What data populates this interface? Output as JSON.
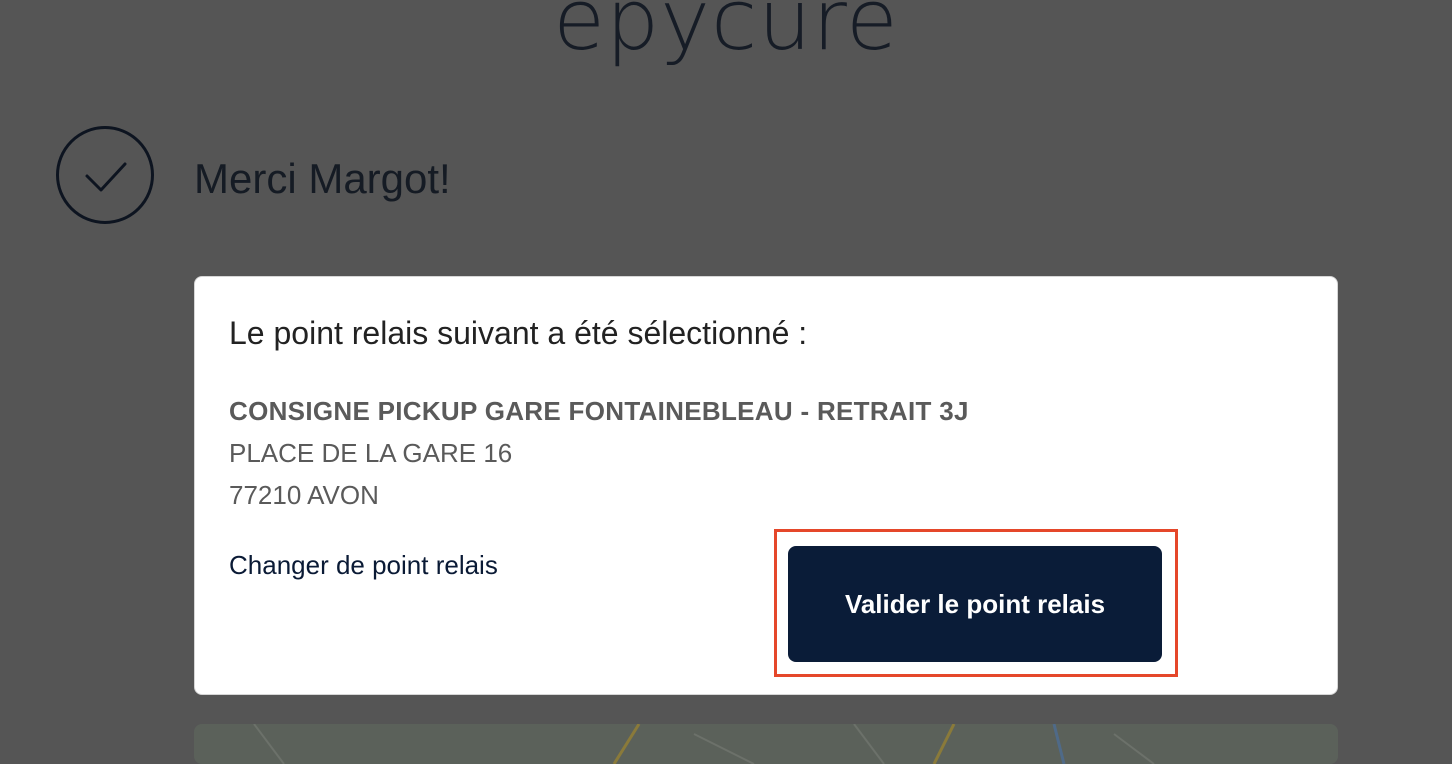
{
  "header": {
    "logo_text": "epycure"
  },
  "confirmation": {
    "icon": "check-circle-icon",
    "message": "Merci Margot!"
  },
  "relay_card": {
    "title": "Le point relais suivant a été sélectionné :",
    "address": {
      "name": "CONSIGNE PICKUP GARE FONTAINEBLEAU - RETRAIT 3J",
      "street": "PLACE DE LA GARE 16",
      "city": "77210 AVON"
    },
    "change_link": "Changer de point relais",
    "validate_button": "Valider le point relais"
  },
  "colors": {
    "overlay": "#555555",
    "button": "#0a1c38",
    "highlight": "#e5472a",
    "card": "#ffffff"
  }
}
